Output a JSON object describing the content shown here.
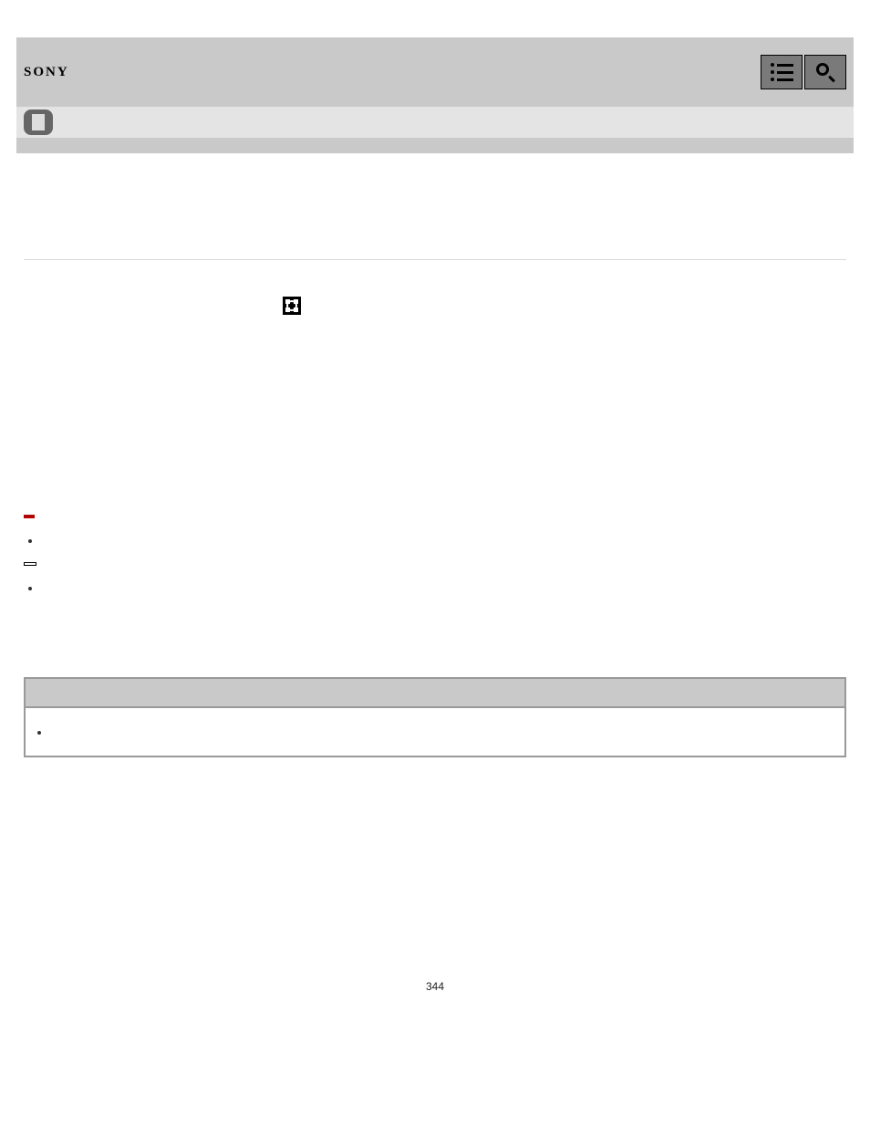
{
  "header": {
    "brand": "SONY"
  },
  "options": {
    "badge": "",
    "item1": "",
    "box": "",
    "item2": ""
  },
  "note": {
    "heading": "",
    "item": ""
  },
  "page_number": "344"
}
